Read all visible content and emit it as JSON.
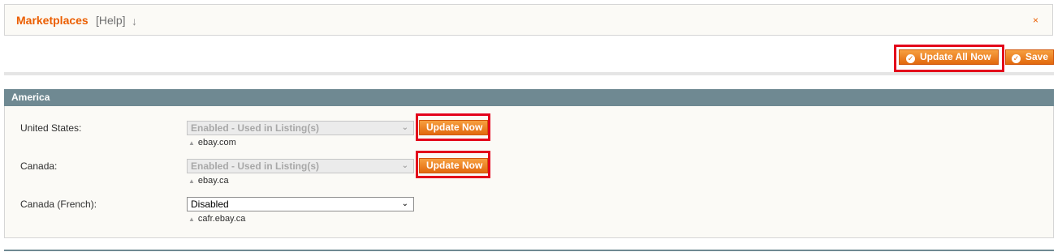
{
  "header": {
    "title": "Marketplaces",
    "help": "[Help]",
    "arrow": "↓",
    "close": "×"
  },
  "toolbar": {
    "update_all_label": "Update All Now",
    "save_label": "Save"
  },
  "section": {
    "title": "America",
    "rows": [
      {
        "label": "United States:",
        "value": "Enabled - Used in Listing(s)",
        "note": "ebay.com",
        "update_label": "Update Now"
      },
      {
        "label": "Canada:",
        "value": "Enabled - Used in Listing(s)",
        "note": "ebay.ca",
        "update_label": "Update Now"
      },
      {
        "label": "Canada (French):",
        "value": "Disabled",
        "note": "cafr.ebay.ca"
      }
    ]
  }
}
